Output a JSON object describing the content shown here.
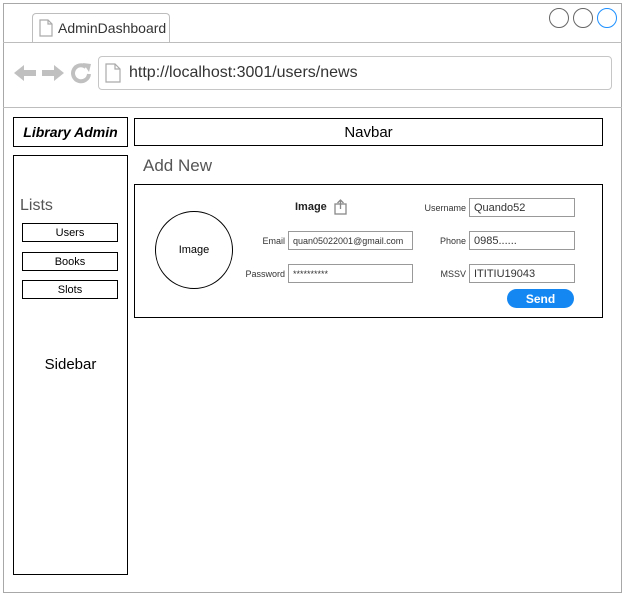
{
  "browser": {
    "tab_title": "AdminDashboard",
    "url": "http://localhost:3001/users/news"
  },
  "brand": "Library Admin",
  "navbar": {
    "label": "Navbar"
  },
  "sidebar": {
    "lists_title": "Lists",
    "items": [
      {
        "label": "Users"
      },
      {
        "label": "Books"
      },
      {
        "label": "Slots"
      }
    ],
    "label": "Sidebar"
  },
  "main": {
    "title": "Add New",
    "form": {
      "avatar_label": "Image",
      "image_label": "Image",
      "email_label": "Email",
      "email_value": "quan05022001@gmail.com",
      "password_label": "Password",
      "password_value": "**********",
      "username_label": "Username",
      "username_value": "Quando52",
      "phone_label": "Phone",
      "phone_value": "0985......",
      "mssv_label": "MSSV",
      "mssv_value": "ITITIU19043",
      "send_label": "Send"
    }
  },
  "colors": {
    "accent": "#1587f2",
    "window_border": "#a8a8a8",
    "control_blue": "#1e90ff"
  }
}
